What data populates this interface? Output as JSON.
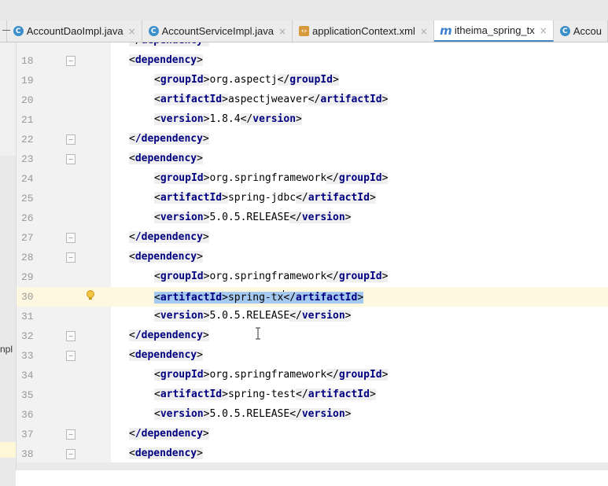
{
  "tabs": [
    {
      "icon": "class-icon",
      "label": "AccountDaoImpl.java",
      "close": "×",
      "active": false
    },
    {
      "icon": "class-icon",
      "label": "AccountServiceImpl.java",
      "close": "×",
      "active": false
    },
    {
      "icon": "xml-file-icon",
      "label": "applicationContext.xml",
      "close": "×",
      "active": false
    },
    {
      "icon": "maven-icon",
      "label": "itheima_spring_tx",
      "close": "×",
      "active": true
    },
    {
      "icon": "class-icon",
      "label": "Accou",
      "close": "",
      "active": false
    }
  ],
  "side_panel": {
    "truncated_text": "npl"
  },
  "editor": {
    "current_line": "30",
    "lines": [
      {
        "num": "18",
        "open": "<",
        "tag": "dependency",
        "close": ">"
      },
      {
        "num": "19",
        "tag": "groupId",
        "value": "org.aspectj"
      },
      {
        "num": "20",
        "tag": "artifactId",
        "value": "aspectjweaver"
      },
      {
        "num": "21",
        "tag": "version",
        "value": "1.8.4"
      },
      {
        "num": "22",
        "tag": "/dependency"
      },
      {
        "num": "23",
        "tag": "dependency"
      },
      {
        "num": "24",
        "tag": "groupId",
        "value": "org.springframework"
      },
      {
        "num": "25",
        "tag": "artifactId",
        "value": "spring-jdbc"
      },
      {
        "num": "26",
        "tag": "version",
        "value": "5.0.5.RELEASE"
      },
      {
        "num": "27",
        "tag": "/dependency"
      },
      {
        "num": "28",
        "tag": "dependency"
      },
      {
        "num": "29",
        "tag": "groupId",
        "value": "org.springframework"
      },
      {
        "num": "30",
        "tag": "artifactId",
        "value": "spring-tx"
      },
      {
        "num": "31",
        "tag": "version",
        "value": "5.0.5.RELEASE"
      },
      {
        "num": "32",
        "tag": "/dependency"
      },
      {
        "num": "33",
        "tag": "dependency"
      },
      {
        "num": "34",
        "tag": "groupId",
        "value": "org.springframework"
      },
      {
        "num": "35",
        "tag": "artifactId",
        "value": "spring-test"
      },
      {
        "num": "36",
        "tag": "version",
        "value": "5.0.5.RELEASE"
      },
      {
        "num": "37",
        "tag": "/dependency"
      },
      {
        "num": "38",
        "tag": "dependency"
      }
    ]
  },
  "colors": {
    "tag": "#000080",
    "selection": "#a6c9f0",
    "current_line": "#fff8e0",
    "active_tab_underline": "#4a88c7"
  }
}
